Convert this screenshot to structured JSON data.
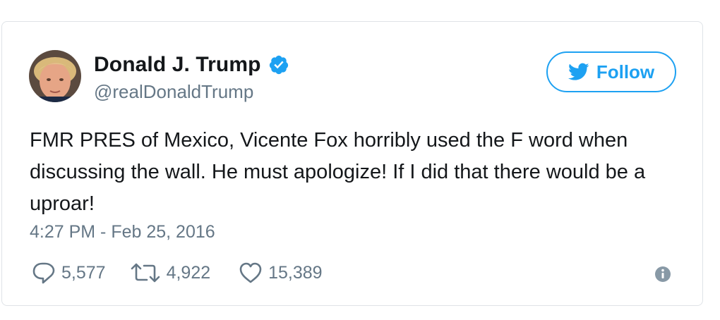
{
  "user": {
    "display_name": "Donald J. Trump",
    "handle": "@realDonaldTrump",
    "verified": true
  },
  "follow_button": {
    "label": "Follow",
    "icon": "twitter-bird-icon"
  },
  "tweet": {
    "text": "FMR PRES of Mexico, Vicente Fox horribly used the F word when discussing the wall. He must apologize! If I did that there would be a uproar!",
    "timestamp": "4:27 PM - Feb 25, 2016"
  },
  "actions": {
    "replies": "5,577",
    "retweets": "4,922",
    "likes": "15,389"
  },
  "colors": {
    "accent": "#1da1f2",
    "muted": "#657786",
    "text": "#14171a",
    "border": "#dfe3e7"
  }
}
